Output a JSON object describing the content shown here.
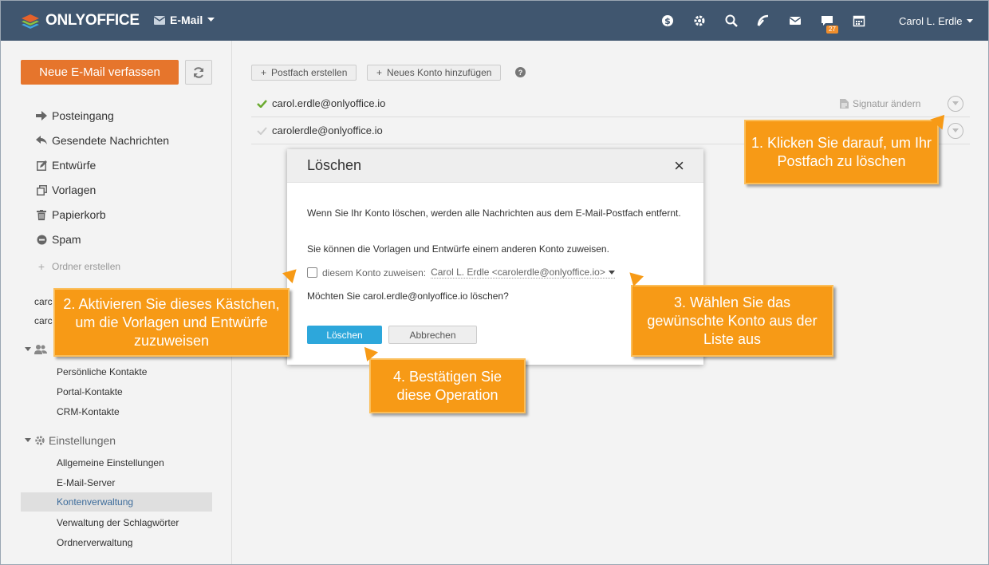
{
  "header": {
    "logo_text": "ONLYOFFICE",
    "module": "E-Mail",
    "user_name": "Carol L. Erdle",
    "talk_badge": "27",
    "icons": [
      "payment-icon",
      "settings-icon",
      "search-icon",
      "feed-icon",
      "mail-icon",
      "talk-icon",
      "calendar-icon"
    ]
  },
  "sidebar": {
    "compose": "Neue E-Mail verfassen",
    "folders": [
      {
        "label": "Posteingang",
        "icon": "inbox-arrow-icon"
      },
      {
        "label": "Gesendete Nachrichten",
        "icon": "reply-arrow-icon"
      },
      {
        "label": "Entwürfe",
        "icon": "edit-icon"
      },
      {
        "label": "Vorlagen",
        "icon": "template-icon"
      },
      {
        "label": "Papierkorb",
        "icon": "trash-icon"
      },
      {
        "label": "Spam",
        "icon": "spam-icon"
      }
    ],
    "create_folder": "Ordner erstellen",
    "accounts_stub": [
      "carc",
      "carc"
    ],
    "contacts": {
      "items": [
        "Persönliche Kontakte",
        "Portal-Kontakte",
        "CRM-Kontakte"
      ]
    },
    "settings": {
      "label": "Einstellungen",
      "items": [
        "Allgemeine Einstellungen",
        "E-Mail-Server",
        "Kontenverwaltung",
        "Verwaltung der Schlagwörter",
        "Ordnerverwaltung"
      ],
      "active": "Kontenverwaltung"
    }
  },
  "main": {
    "toolbar": {
      "create_mailbox": "Postfach erstellen",
      "add_account": "Neues Konto hinzufügen",
      "help": "?"
    },
    "accounts": [
      {
        "email": "carol.erdle@onlyoffice.io",
        "signature": "Signatur ändern",
        "default": true
      },
      {
        "email": "carolerdle@onlyoffice.io",
        "signature": "",
        "default": false
      }
    ]
  },
  "dialog": {
    "title": "Löschen",
    "close": "×",
    "text1": "Wenn Sie Ihr Konto löschen, werden alle Nachrichten aus dem E-Mail-Postfach entfernt.",
    "text2": "Sie können die Vorlagen und Entwürfe einem anderen Konto zuweisen.",
    "assign_label": "diesem Konto zuweisen:",
    "assign_account": "Carol L. Erdle <carolerdle@onlyoffice.io>",
    "question": "Möchten Sie carol.erdle@onlyoffice.io löschen?",
    "confirm": "Löschen",
    "cancel": "Abbrechen"
  },
  "callouts": {
    "c1": "1. Klicken Sie darauf, um Ihr Postfach zu löschen",
    "c2": "2. Aktivieren Sie dieses Kästchen, um die Vorlagen und Entwürfe zuzuweisen",
    "c3": "3. Wählen Sie das gewünschte Konto aus der Liste aus",
    "c4": "4. Bestätigen Sie diese Operation"
  },
  "colors": {
    "header": "#40566f",
    "compose": "#e6752c",
    "primary": "#2da7db",
    "callout": "#f79a16",
    "active_link": "#3d6c9b"
  }
}
